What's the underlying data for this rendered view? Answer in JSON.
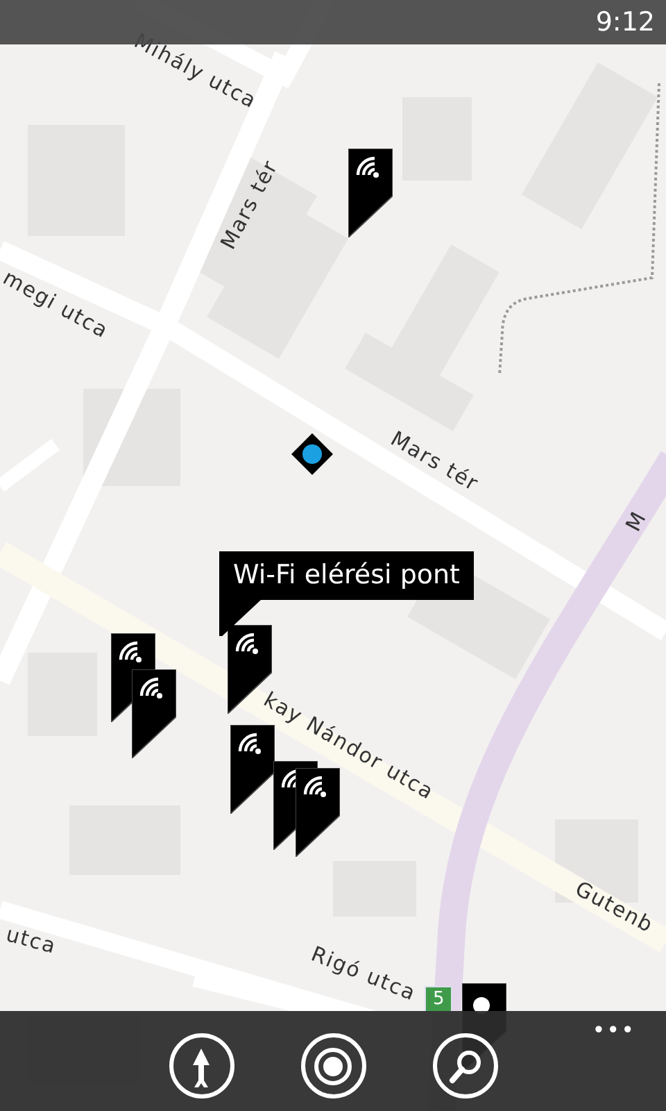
{
  "status_bar": {
    "time": "9:12"
  },
  "map": {
    "street_labels": [
      {
        "text": "Mihály utca"
      },
      {
        "text": "Mars tér"
      },
      {
        "text": "megi utca"
      },
      {
        "text": "Mars tér"
      },
      {
        "text": "kay Nándor utca"
      },
      {
        "text": "Gutenb"
      },
      {
        "text": "utca"
      },
      {
        "text": "Rigó utca"
      },
      {
        "text": "M"
      }
    ],
    "route_shield": "5",
    "pins": [
      {
        "kind": "wifi"
      },
      {
        "kind": "wifi"
      },
      {
        "kind": "wifi"
      },
      {
        "kind": "wifi"
      },
      {
        "kind": "wifi"
      },
      {
        "kind": "wifi"
      },
      {
        "kind": "wifi"
      },
      {
        "kind": "dot"
      }
    ],
    "tooltip": "Wi-Fi elérési pont"
  },
  "app_bar": {
    "buttons": [
      {
        "kind": "directions"
      },
      {
        "kind": "locate"
      },
      {
        "kind": "search"
      }
    ],
    "more": "•••"
  }
}
